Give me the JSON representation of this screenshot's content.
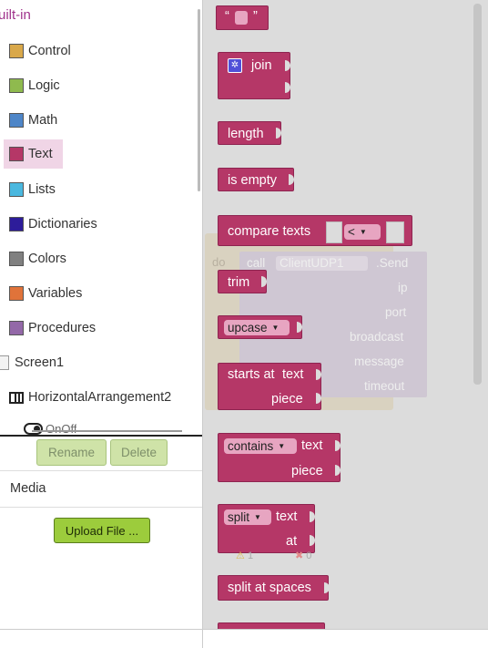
{
  "palette": {
    "title": "uilt-in",
    "categories": [
      {
        "label": "Control",
        "color": "#d9a84a"
      },
      {
        "label": "Logic",
        "color": "#8fba4e"
      },
      {
        "label": "Math",
        "color": "#4e86c8"
      },
      {
        "label": "Text",
        "color": "#b53767",
        "selected": true
      },
      {
        "label": "Lists",
        "color": "#4ab8df"
      },
      {
        "label": "Dictionaries",
        "color": "#2d1c9a"
      },
      {
        "label": "Colors",
        "color": "#808080"
      },
      {
        "label": "Variables",
        "color": "#e0733a"
      },
      {
        "label": "Procedures",
        "color": "#9368a8"
      }
    ]
  },
  "components": {
    "screen": "Screen1",
    "horizontal": "HorizontalArrangement2",
    "partial": "OnOff",
    "rename": "Rename",
    "delete": "Delete"
  },
  "media": {
    "label": "Media",
    "upload": "Upload File ..."
  },
  "workspace": {
    "string_open": "“",
    "string_close": "”",
    "join": "join",
    "length": "length",
    "is_empty": "is empty",
    "compare_texts": "compare texts",
    "compare_op": "<",
    "trim": "trim",
    "upcase": "upcase",
    "starts_at": "starts at",
    "text": "text",
    "piece": "piece",
    "contains": "contains",
    "split": "split",
    "at": "at",
    "split_at_spaces": "split at spaces",
    "ghost": {
      "do": "do",
      "call": "call",
      "component": "ClientUDP1",
      "method": ".Send",
      "ip": "ip",
      "port": "port",
      "broadcast": "broadcast",
      "message": "message",
      "timeout": "timeout"
    },
    "warnings": "1",
    "errors": "0"
  }
}
